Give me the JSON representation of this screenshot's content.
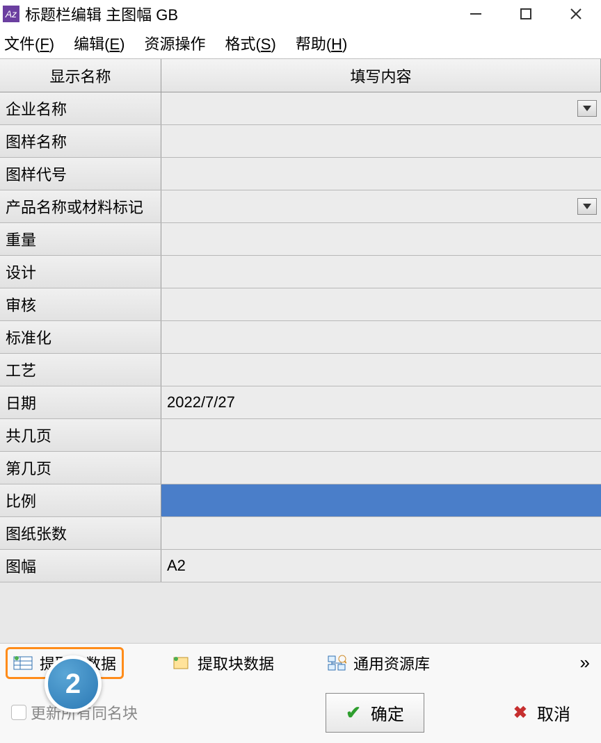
{
  "window": {
    "title": "标题栏编辑 主图幅 GB"
  },
  "menu": {
    "file": "文件(",
    "file_u": "F",
    "file_end": ")",
    "edit": "编辑(",
    "edit_u": "E",
    "edit_end": ")",
    "resource": "资源操作",
    "format": "格式(",
    "format_u": "S",
    "format_end": ")",
    "help": "帮助(",
    "help_u": "H",
    "help_end": ")"
  },
  "headers": {
    "name": "显示名称",
    "content": "填写内容"
  },
  "rows": [
    {
      "label": "企业名称",
      "value": "",
      "dropdown": true
    },
    {
      "label": "图样名称",
      "value": ""
    },
    {
      "label": "图样代号",
      "value": ""
    },
    {
      "label": "产品名称或材料标记",
      "value": "",
      "dropdown": true
    },
    {
      "label": "重量",
      "value": ""
    },
    {
      "label": "设计",
      "value": ""
    },
    {
      "label": "审核",
      "value": ""
    },
    {
      "label": "标准化",
      "value": ""
    },
    {
      "label": "工艺",
      "value": ""
    },
    {
      "label": "日期",
      "value": "2022/7/27"
    },
    {
      "label": "共几页",
      "value": ""
    },
    {
      "label": "第几页",
      "value": ""
    },
    {
      "label": "比例",
      "value": "",
      "selected": true
    },
    {
      "label": "图纸张数",
      "value": ""
    },
    {
      "label": "图幅",
      "value": "A2"
    }
  ],
  "toolbar": {
    "extract_table": "提取表数据",
    "extract_block": "提取块数据",
    "resource_lib": "通用资源库"
  },
  "bottom": {
    "update_same_blocks": "更新所有同名块",
    "ok": "确定",
    "cancel": "取消"
  },
  "annotation": {
    "step": "2"
  }
}
